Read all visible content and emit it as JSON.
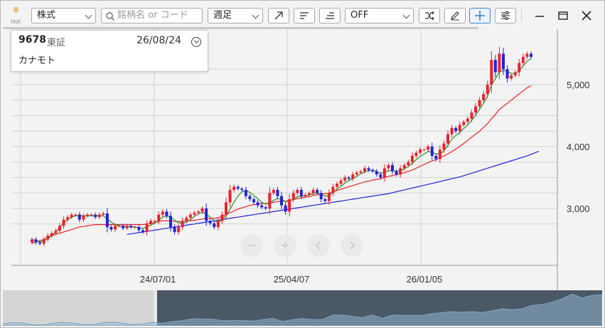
{
  "toolbar": {
    "hot_label": "Hot",
    "market_select": "株式",
    "search_placeholder": "銘柄名 or コード",
    "period_select": "週足",
    "indicator_select": "OFF"
  },
  "info_card": {
    "code": "9678",
    "exchange": "東証",
    "date": "26/08/24",
    "name": "カナモト"
  },
  "chart_data": {
    "type": "candlestick",
    "y_ticks": [
      3000,
      4000,
      5000
    ],
    "y_tick_labels": [
      "3,000",
      "4,000",
      "5,000"
    ],
    "x_tick_labels": [
      "24/07/01",
      "25/04/07",
      "26/01/05"
    ],
    "grid": true,
    "up_color": "#e8242b",
    "down_color": "#2323d8",
    "ma_short_color": "#23922a",
    "ma_mid_color": "#e8242b",
    "ma_long_color": "#2323d8",
    "closes": [
      2500,
      2450,
      2430,
      2500,
      2560,
      2600,
      2640,
      2720,
      2820,
      2860,
      2900,
      2900,
      2820,
      2880,
      2900,
      2900,
      2860,
      2900,
      2920,
      2700,
      2660,
      2720,
      2720,
      2680,
      2720,
      2700,
      2700,
      2650,
      2620,
      2750,
      2800,
      2800,
      2900,
      2950,
      2880,
      2700,
      2620,
      2700,
      2800,
      2850,
      2900,
      2930,
      2950,
      3000,
      2800,
      2760,
      2700,
      2800,
      2900,
      3100,
      3300,
      3350,
      3320,
      3300,
      3200,
      3150,
      3100,
      3050,
      3020,
      3000,
      3250,
      3300,
      3200,
      3050,
      2950,
      3150,
      3250,
      3300,
      3200,
      3220,
      3250,
      3300,
      3250,
      3150,
      3120,
      3250,
      3350,
      3400,
      3450,
      3500,
      3480,
      3550,
      3580,
      3600,
      3650,
      3620,
      3600,
      3550,
      3500,
      3650,
      3700,
      3600,
      3550,
      3650,
      3700,
      3750,
      3850,
      3900,
      3950,
      3950,
      4000,
      3850,
      3800,
      3950,
      4050,
      4200,
      4300,
      4250,
      4350,
      4400,
      4450,
      4550,
      4650,
      4750,
      4850,
      5000,
      5400,
      5200,
      5500,
      5250,
      5100,
      5150,
      5200,
      5350,
      5450,
      5500,
      5450
    ],
    "ma_short": [
      2500,
      2480,
      2460,
      2480,
      2510,
      2560,
      2620,
      2700,
      2760,
      2820,
      2860,
      2880,
      2880,
      2880,
      2880,
      2880,
      2880,
      2890,
      2880,
      2830,
      2780,
      2740,
      2720,
      2710,
      2710,
      2700,
      2700,
      2690,
      2680,
      2700,
      2730,
      2760,
      2810,
      2860,
      2880,
      2860,
      2810,
      2770,
      2760,
      2780,
      2820,
      2870,
      2910,
      2940,
      2910,
      2860,
      2800,
      2780,
      2810,
      2880,
      2990,
      3100,
      3200,
      3270,
      3290,
      3260,
      3210,
      3160,
      3100,
      3070,
      3090,
      3130,
      3160,
      3150,
      3110,
      3120,
      3150,
      3190,
      3200,
      3200,
      3220,
      3240,
      3250,
      3230,
      3200,
      3210,
      3260,
      3310,
      3360,
      3410,
      3450,
      3480,
      3520,
      3560,
      3590,
      3610,
      3620,
      3600,
      3570,
      3580,
      3610,
      3610,
      3600,
      3610,
      3640,
      3680,
      3730,
      3790,
      3840,
      3880,
      3920,
      3910,
      3880,
      3880,
      3930,
      4020,
      4120,
      4180,
      4230,
      4290,
      4350,
      4420,
      4510,
      4600,
      4700,
      4810,
      5000,
      5100,
      5200,
      5230,
      5220,
      5180,
      5180,
      5230,
      5300,
      5380,
      5420
    ],
    "ma_mid": [
      2440,
      2460,
      2480,
      2500,
      2530,
      2560,
      2580,
      2600,
      2620,
      2640,
      2660,
      2680,
      2700,
      2710,
      2720,
      2730,
      2740,
      2740,
      2740,
      2740,
      2740,
      2740,
      2740,
      2740,
      2740,
      2740,
      2740,
      2740,
      2740,
      2750,
      2760,
      2770,
      2790,
      2800,
      2800,
      2800,
      2790,
      2790,
      2790,
      2800,
      2800,
      2810,
      2820,
      2830,
      2840,
      2840,
      2840,
      2850,
      2870,
      2900,
      2930,
      2960,
      2990,
      3010,
      3030,
      3050,
      3060,
      3070,
      3080,
      3080,
      3090,
      3100,
      3110,
      3120,
      3120,
      3130,
      3140,
      3160,
      3170,
      3180,
      3190,
      3210,
      3220,
      3230,
      3240,
      3250,
      3270,
      3290,
      3310,
      3330,
      3350,
      3370,
      3390,
      3410,
      3430,
      3440,
      3460,
      3470,
      3480,
      3500,
      3520,
      3530,
      3550,
      3560,
      3580,
      3600,
      3620,
      3650,
      3680,
      3710,
      3740,
      3770,
      3790,
      3820,
      3850,
      3880,
      3920,
      3960,
      4000,
      4050,
      4100,
      4150,
      4200,
      4250,
      4310,
      4370,
      4450,
      4520,
      4600,
      4650,
      4700,
      4750,
      4800,
      4850,
      4900,
      4950,
      4980
    ],
    "ma_long_start_index": 24,
    "ma_long": [
      2580,
      2590,
      2600,
      2610,
      2620,
      2630,
      2640,
      2650,
      2660,
      2670,
      2680,
      2690,
      2700,
      2710,
      2720,
      2730,
      2740,
      2750,
      2760,
      2770,
      2780,
      2790,
      2800,
      2810,
      2820,
      2830,
      2840,
      2850,
      2860,
      2870,
      2880,
      2890,
      2900,
      2910,
      2920,
      2930,
      2940,
      2950,
      2960,
      2970,
      2980,
      2990,
      3000,
      3010,
      3020,
      3030,
      3040,
      3050,
      3060,
      3070,
      3080,
      3090,
      3100,
      3110,
      3120,
      3130,
      3140,
      3150,
      3160,
      3170,
      3180,
      3190,
      3200,
      3210,
      3220,
      3230,
      3240,
      3255,
      3270,
      3285,
      3300,
      3315,
      3330,
      3345,
      3360,
      3375,
      3390,
      3405,
      3420,
      3435,
      3450,
      3465,
      3480,
      3495,
      3510,
      3530,
      3550,
      3570,
      3590,
      3610,
      3630,
      3650,
      3670,
      3690,
      3710,
      3730,
      3750,
      3770,
      3790,
      3810,
      3830,
      3850,
      3875,
      3900,
      3925
    ]
  }
}
